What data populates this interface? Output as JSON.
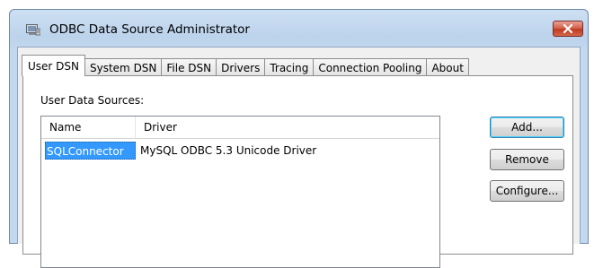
{
  "window": {
    "title": "ODBC Data Source Administrator",
    "icon": "odbc-admin-icon",
    "close_icon": "close-icon"
  },
  "tabs": [
    {
      "label": "User DSN",
      "active": true
    },
    {
      "label": "System DSN",
      "active": false
    },
    {
      "label": "File DSN",
      "active": false
    },
    {
      "label": "Drivers",
      "active": false
    },
    {
      "label": "Tracing",
      "active": false
    },
    {
      "label": "Connection Pooling",
      "active": false
    },
    {
      "label": "About",
      "active": false
    }
  ],
  "panel": {
    "section_label": "User Data Sources:",
    "columns": [
      "Name",
      "Driver"
    ],
    "rows": [
      {
        "name": "SQLConnector",
        "driver": "MySQL ODBC 5.3 Unicode Driver",
        "selected": true
      }
    ]
  },
  "buttons": {
    "add": "Add...",
    "remove": "Remove",
    "configure": "Configure..."
  },
  "colors": {
    "selection": "#3399ff",
    "close_button": "#c13a1f",
    "title_bar": "#bcd3ec"
  }
}
